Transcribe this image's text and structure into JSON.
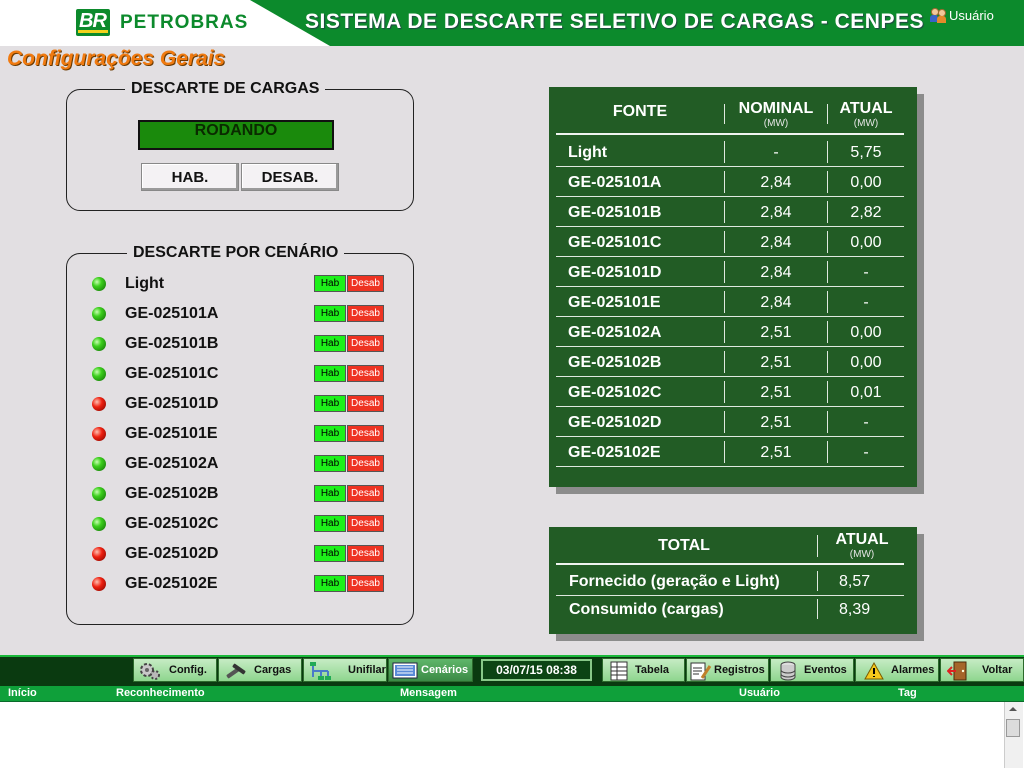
{
  "header": {
    "brand": "PETROBRAS",
    "logo_text": "BR",
    "app_title": "SISTEMA DE DESCARTE SELETIVO DE CARGAS - CENPES",
    "user_label": "Usuário"
  },
  "page_title": "Configurações Gerais",
  "descarte_cargas": {
    "legend": "DESCARTE DE CARGAS",
    "status": "RODANDO",
    "hab_label": "HAB.",
    "desab_label": "DESAB."
  },
  "descarte_cenario": {
    "legend": "DESCARTE POR CENÁRIO",
    "hab_label": "Hab",
    "desab_label": "Desab",
    "items": [
      {
        "name": "Light",
        "state": "green"
      },
      {
        "name": "GE-025101A",
        "state": "green"
      },
      {
        "name": "GE-025101B",
        "state": "green"
      },
      {
        "name": "GE-025101C",
        "state": "green"
      },
      {
        "name": "GE-025101D",
        "state": "red"
      },
      {
        "name": "GE-025101E",
        "state": "red"
      },
      {
        "name": "GE-025102A",
        "state": "green"
      },
      {
        "name": "GE-025102B",
        "state": "green"
      },
      {
        "name": "GE-025102C",
        "state": "green"
      },
      {
        "name": "GE-025102D",
        "state": "red"
      },
      {
        "name": "GE-025102E",
        "state": "red"
      }
    ]
  },
  "fonte_table": {
    "col_fonte": "FONTE",
    "col_nominal": "NOMINAL",
    "col_atual": "ATUAL",
    "unit": "(MW)",
    "rows": [
      {
        "fonte": "Light",
        "nominal": "-",
        "atual": "5,75"
      },
      {
        "fonte": "GE-025101A",
        "nominal": "2,84",
        "atual": "0,00"
      },
      {
        "fonte": "GE-025101B",
        "nominal": "2,84",
        "atual": "2,82"
      },
      {
        "fonte": "GE-025101C",
        "nominal": "2,84",
        "atual": "0,00"
      },
      {
        "fonte": "GE-025101D",
        "nominal": "2,84",
        "atual": "-"
      },
      {
        "fonte": "GE-025101E",
        "nominal": "2,84",
        "atual": "-"
      },
      {
        "fonte": "GE-025102A",
        "nominal": "2,51",
        "atual": "0,00"
      },
      {
        "fonte": "GE-025102B",
        "nominal": "2,51",
        "atual": "0,00"
      },
      {
        "fonte": "GE-025102C",
        "nominal": "2,51",
        "atual": "0,01"
      },
      {
        "fonte": "GE-025102D",
        "nominal": "2,51",
        "atual": "-"
      },
      {
        "fonte": "GE-025102E",
        "nominal": "2,51",
        "atual": "-"
      }
    ]
  },
  "total_table": {
    "col_total": "TOTAL",
    "col_atual": "ATUAL",
    "unit": "(MW)",
    "rows": [
      {
        "label": "Fornecido (geração e Light)",
        "value": "8,57"
      },
      {
        "label": "Consumido (cargas)",
        "value": "8,39"
      }
    ]
  },
  "toolbar": {
    "config": "Config.",
    "cargas": "Cargas",
    "unifilar": "Unifilar",
    "cenarios": "Cenários",
    "datetime": "03/07/15 08:38",
    "tabela": "Tabela",
    "registros": "Registros",
    "eventos": "Eventos",
    "alarmes": "Alarmes",
    "voltar": "Voltar"
  },
  "alarm_grid": {
    "columns": [
      "Início",
      "Reconhecimento",
      "Mensagem",
      "Usuário",
      "Tag"
    ]
  },
  "colors": {
    "header_green": "#0c8a2c",
    "panel_green": "#225c25",
    "title_orange": "#f07a10",
    "led_green": "#3ccf1c",
    "led_red": "#ee2010"
  }
}
